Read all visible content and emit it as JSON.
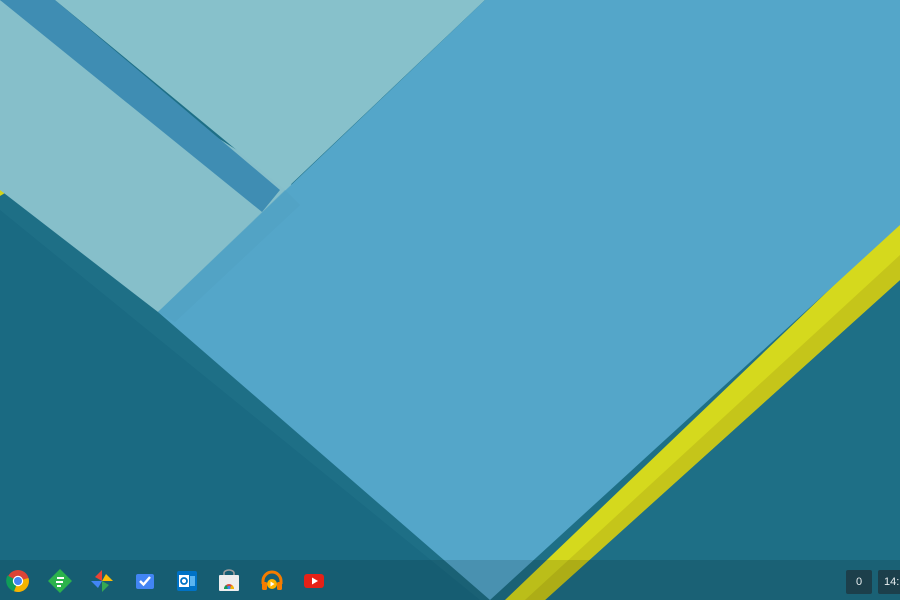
{
  "shelf": {
    "apps": [
      {
        "icon": "chrome-icon"
      },
      {
        "icon": "feedly-icon"
      },
      {
        "icon": "google-photos-icon"
      },
      {
        "icon": "inbox-icon"
      },
      {
        "icon": "outlook-icon"
      },
      {
        "icon": "web-store-icon"
      },
      {
        "icon": "play-music-icon"
      },
      {
        "icon": "youtube-icon"
      }
    ]
  },
  "status_area": {
    "notification_count": "0",
    "clock": "14:"
  },
  "colors": {
    "background_teal": "#1e6f86",
    "panel_blue": "#54a6c9",
    "panel_light": "#86bfca",
    "stripe_blue": "#3f8db3",
    "accent_yellow": "#d7db1e"
  }
}
